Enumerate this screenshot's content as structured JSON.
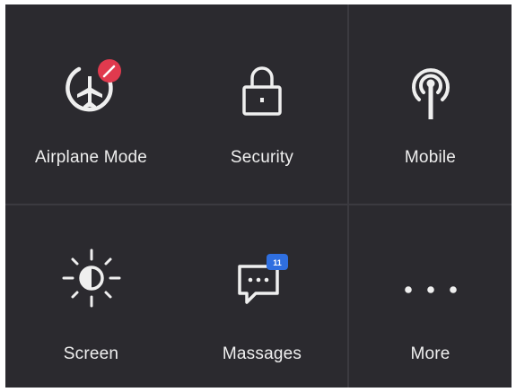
{
  "colors": {
    "background": "#2b2a2f",
    "divider": "#3b3a40",
    "text": "#efefef",
    "airplane_badge": "#e03a4e",
    "messages_badge": "#2f6fe0"
  },
  "tiles": [
    {
      "label": "Airplane Mode",
      "icon": "airplane-icon"
    },
    {
      "label": "Security",
      "icon": "lock-icon"
    },
    {
      "label": "Mobile",
      "icon": "antenna-icon"
    },
    {
      "label": "Screen",
      "icon": "brightness-icon"
    },
    {
      "label": "Massages",
      "icon": "message-icon",
      "badge": "11"
    },
    {
      "label": "More",
      "icon": "more-icon"
    }
  ]
}
